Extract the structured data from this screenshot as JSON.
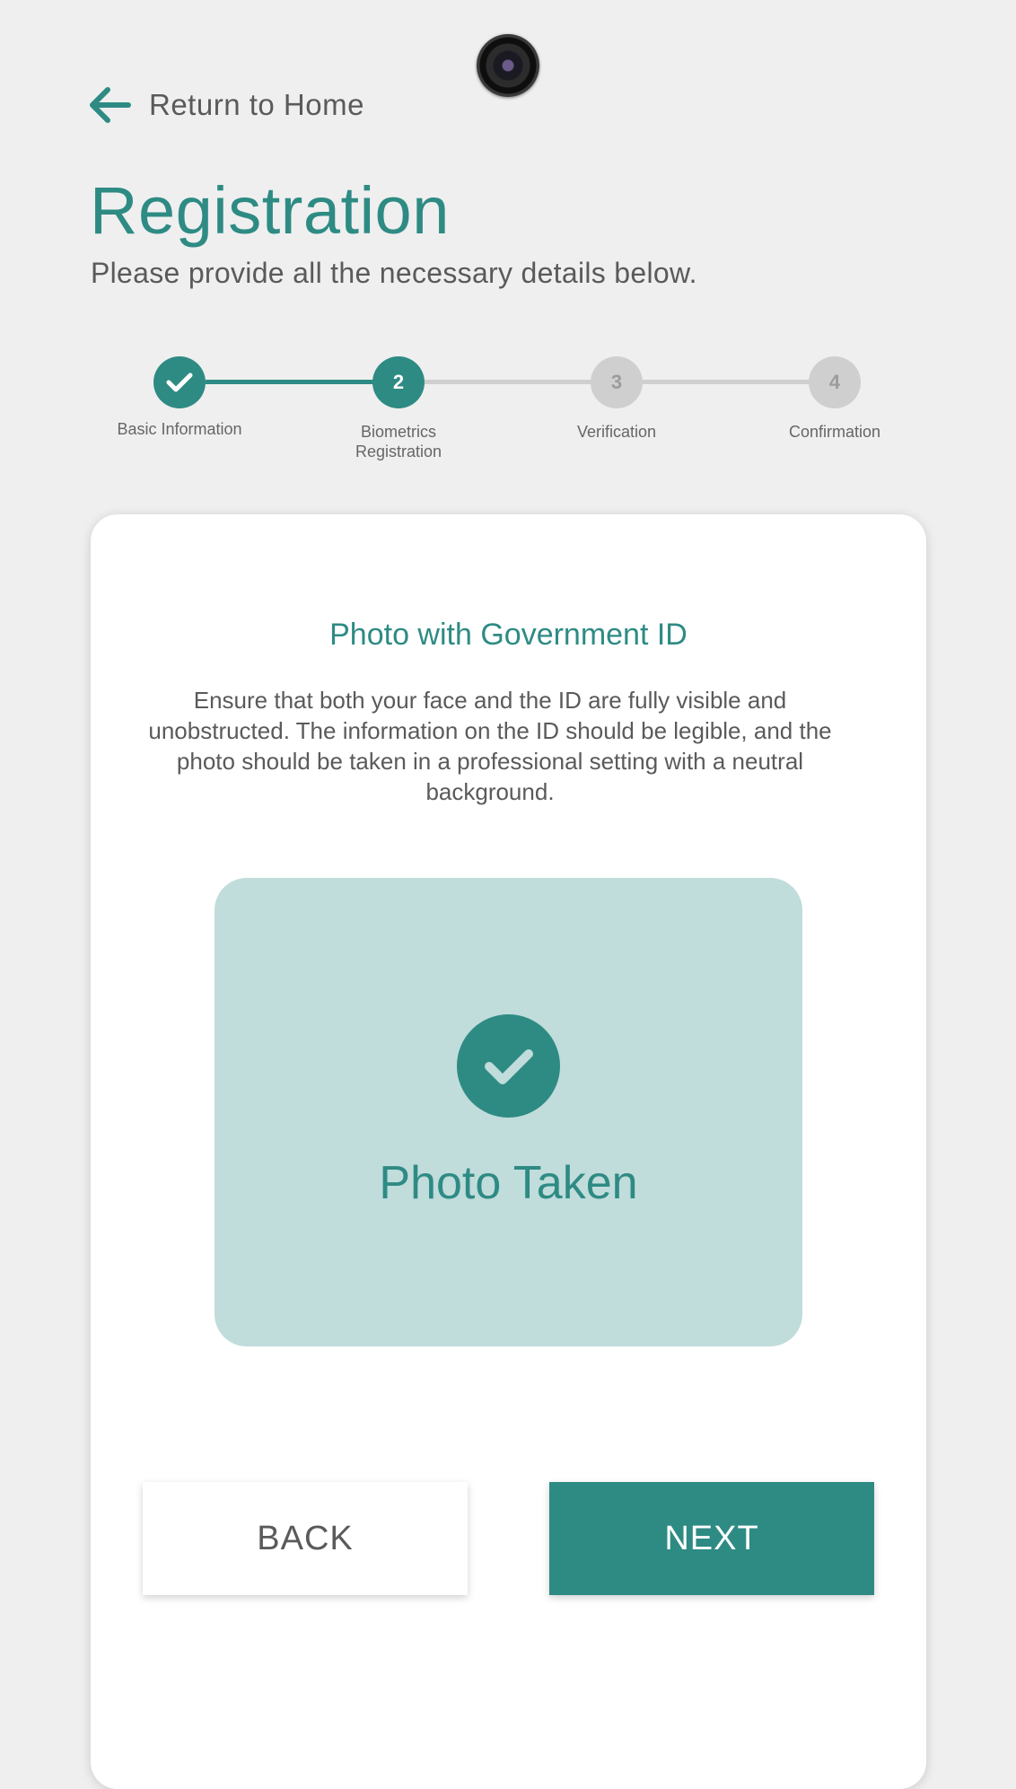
{
  "nav": {
    "back_label": "Return to Home"
  },
  "header": {
    "title": "Registration",
    "subtitle": "Please provide all the necessary details below."
  },
  "stepper": {
    "steps": [
      {
        "number": "1",
        "label": "Basic Information",
        "state": "done"
      },
      {
        "number": "2",
        "label": "Biometrics Registration",
        "state": "active"
      },
      {
        "number": "3",
        "label": "Verification",
        "state": "pending"
      },
      {
        "number": "4",
        "label": "Confirmation",
        "state": "pending"
      }
    ]
  },
  "card": {
    "section_title": "Photo with Government ID",
    "description": "Ensure that both your face and the ID are fully visible and unobstructed. The information on the ID should be legible, and the photo should be taken in a professional setting with a neutral background.",
    "photo_status": "Photo Taken",
    "back_label": "BACK",
    "next_label": "NEXT"
  },
  "colors": {
    "accent": "#2e8b84",
    "accent_light": "#c0dcdb",
    "background": "#efefef",
    "inactive": "#cfcfcf"
  },
  "icons": {
    "back": "arrow-left-icon",
    "check": "check-icon",
    "camera": "camera-lens-icon"
  }
}
